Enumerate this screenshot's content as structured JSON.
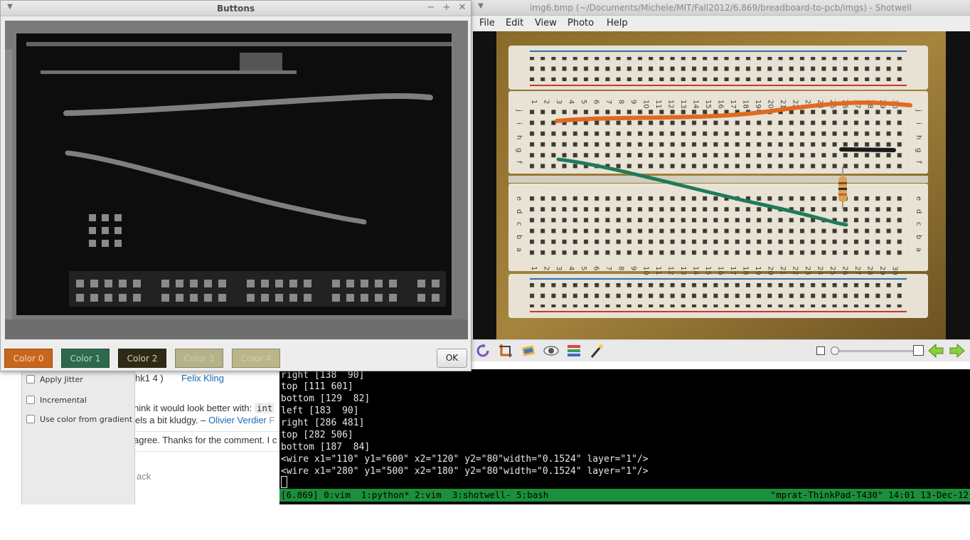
{
  "buttons_window": {
    "title": "Buttons",
    "color_buttons": [
      {
        "label": "Color 0",
        "bg": "#c8661b",
        "fg": "#f0d6c2"
      },
      {
        "label": "Color 1",
        "bg": "#2d6a4c",
        "fg": "#b9d9c6"
      },
      {
        "label": "Color 2",
        "bg": "#2e2a15",
        "fg": "#d8d2b4"
      },
      {
        "label": "Color 3",
        "bg": "#b5b28a",
        "fg": "#cfcca6"
      },
      {
        "label": "Color 4",
        "bg": "#bdb58a",
        "fg": "#d6cea4"
      }
    ],
    "ok_label": "OK"
  },
  "shotwell": {
    "title": "img6.bmp (~/Documents/Michele/MIT/Fall2012/6.869/breadboard-to-pcb/imgs) - Shotwell",
    "menu": [
      "File",
      "Edit",
      "View",
      "Photo",
      "Help"
    ],
    "toolbar_icons": [
      "rotate-icon",
      "crop-icon",
      "straighten-icon",
      "redeye-icon",
      "adjust-icon",
      "enhance-icon"
    ],
    "zoom_level": 0.0,
    "breadboard_top_numbers": [
      "1",
      "2",
      "3",
      "4",
      "5",
      "6",
      "7",
      "8",
      "9",
      "10",
      "11",
      "12",
      "13",
      "14",
      "15",
      "16",
      "17",
      "18",
      "19",
      "20",
      "21",
      "22",
      "23",
      "24",
      "25",
      "26",
      "27",
      "28",
      "29",
      "30"
    ],
    "breadboard_row_letters_top": [
      "j",
      "i",
      "h",
      "g",
      "f"
    ],
    "breadboard_row_letters_bottom": [
      "e",
      "d",
      "c",
      "b",
      "a"
    ]
  },
  "background_page": {
    "options": [
      "Apply Jitter",
      "Incremental",
      "Use color from gradient"
    ],
    "fragments": {
      "line1_a": "hk1 4 )",
      "line1_user": "Felix Kling",
      "line2": "hink it would look better with:",
      "line2_code": "int",
      "line3": "els a bit kludgy. –",
      "line3_user": "Olivier Verdier",
      "line3_tail": "F",
      "line4": "agree. Thanks for the comment. I c",
      "back": "ack"
    }
  },
  "terminal": {
    "lines": [
      "right [138  90]",
      "top [111 601]",
      "bottom [129  82]",
      "left [183  90]",
      "right [286 481]",
      "top [282 506]",
      "bottom [187  84]",
      "<wire x1=\"110\" y1=\"600\" x2=\"120\" y2=\"80\"width=\"0.1524\" layer=\"1\"/>",
      "<wire x1=\"280\" y1=\"500\" x2=\"180\" y2=\"80\"width=\"0.1524\" layer=\"1\"/>"
    ],
    "tmux_left": "[6.869] 0:vim  1:python* 2:vim  3:shotwell- 5:bash",
    "tmux_right": "\"mprat-ThinkPad-T430\" 14:01 13-Dec-12"
  }
}
